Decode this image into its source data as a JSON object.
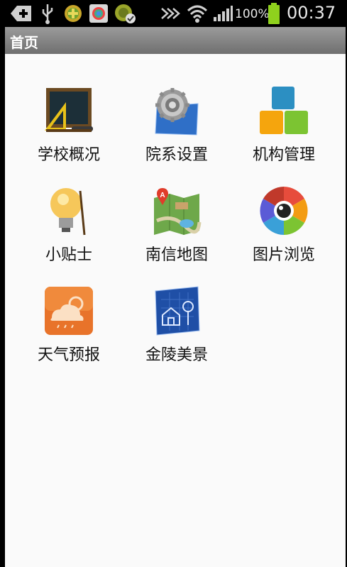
{
  "status_bar": {
    "battery_percent": "100%",
    "time": "00:37"
  },
  "header": {
    "title": "首页"
  },
  "grid": {
    "items": [
      {
        "label": "学校概况",
        "icon": "chalkboard-icon"
      },
      {
        "label": "院系设置",
        "icon": "gear-blueprint-icon"
      },
      {
        "label": "机构管理",
        "icon": "blocks-icon"
      },
      {
        "label": "小贴士",
        "icon": "lightbulb-icon"
      },
      {
        "label": "南信地图",
        "icon": "map-icon"
      },
      {
        "label": "图片浏览",
        "icon": "camera-aperture-icon"
      },
      {
        "label": "天气预报",
        "icon": "weather-icon"
      },
      {
        "label": "金陵美景",
        "icon": "scenery-blueprint-icon"
      }
    ]
  }
}
